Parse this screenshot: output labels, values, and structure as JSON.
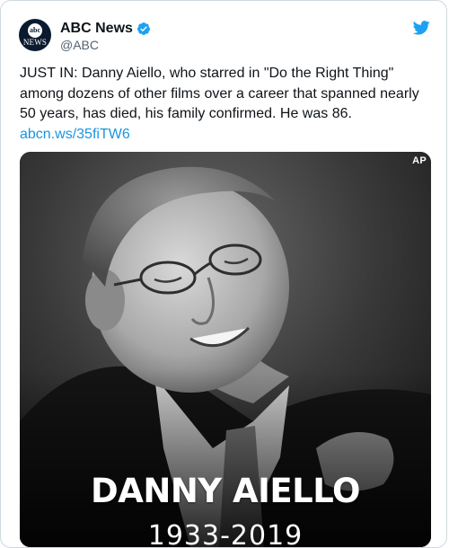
{
  "tweet": {
    "display_name": "ABC News",
    "handle": "@ABC",
    "verified": true,
    "avatar": {
      "top_text": "abc",
      "bottom_text": "NEWS"
    },
    "text": "JUST IN: Danny Aiello, who starred in \"Do the Right Thing\" among dozens of other films over a career that spanned nearly 50 years, has died, his family confirmed. He was 86.",
    "link": "abcn.ws/35fiTW6",
    "colors": {
      "link": "#1b95e0",
      "twitter_blue": "#1da1f2",
      "verified": "#1da1f2",
      "text": "#0f1419",
      "secondary": "#536471"
    }
  },
  "media": {
    "credit": "AP",
    "caption_name": "DANNY AIELLO",
    "caption_years": "1933-2019",
    "description_icon": "portrait-photo"
  },
  "icons": {
    "verified": "verified-badge-icon",
    "brand": "twitter-bird-icon"
  }
}
